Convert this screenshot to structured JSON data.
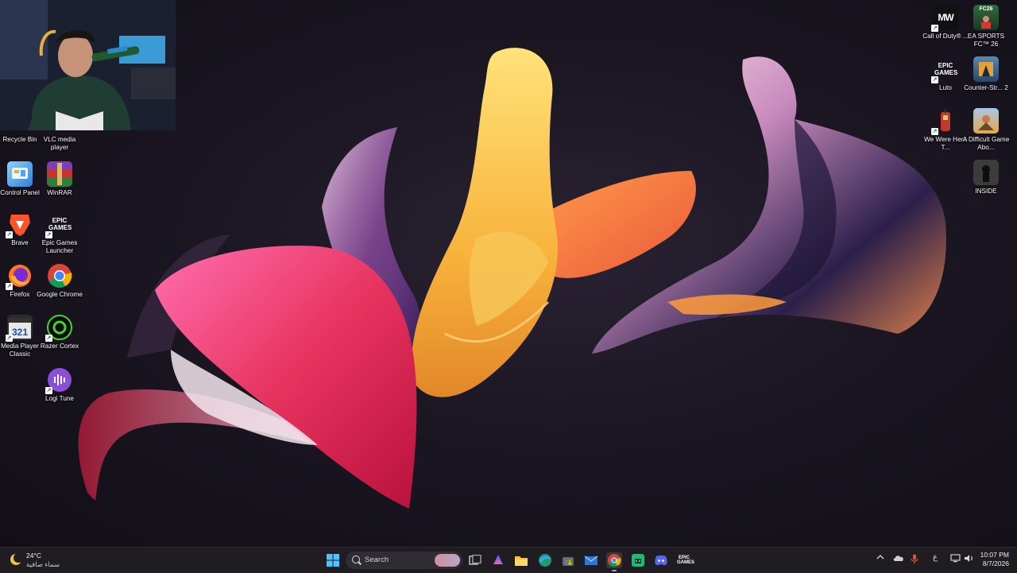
{
  "desktop_icons_left": [
    {
      "label": "Recycle Bin",
      "icon": "recycle-bin-icon"
    },
    {
      "label": "VLC media player",
      "icon": "vlc-icon"
    },
    {
      "label": "Control Panel",
      "icon": "control-panel-icon"
    },
    {
      "label": "WinRAR",
      "icon": "winrar-icon"
    },
    {
      "label": "Brave",
      "icon": "brave-icon"
    },
    {
      "label": "Epic Games Launcher",
      "icon": "epic-games-icon"
    },
    {
      "label": "Firefox",
      "icon": "firefox-icon"
    },
    {
      "label": "Google Chrome",
      "icon": "chrome-icon"
    },
    {
      "label": "Media Player Classic",
      "icon": "media-player-classic-icon"
    },
    {
      "label": "Razer Cortex",
      "icon": "razer-cortex-icon"
    },
    {
      "label": "Logi Tune",
      "icon": "logi-tune-icon"
    }
  ],
  "desktop_icons_right": [
    {
      "label": "Call of Duty® ...",
      "icon": "call-of-duty-icon",
      "glyph": "MW"
    },
    {
      "label": "EA SPORTS FC™ 26",
      "icon": "ea-sports-fc-icon",
      "glyph": "FC26"
    },
    {
      "label": "Luto",
      "icon": "luto-icon",
      "glyph": "EPIC GAMES"
    },
    {
      "label": "Counter-Str... 2",
      "icon": "counter-strike-icon"
    },
    {
      "label": "We Were Here T...",
      "icon": "we-were-here-icon"
    },
    {
      "label": "A Difficult Game Abo...",
      "icon": "difficult-game-icon"
    },
    {
      "label": "INSIDE",
      "icon": "inside-icon"
    }
  ],
  "epic_glyph": "EPIC GAMES",
  "weather": {
    "temp": "24°C",
    "condition": "سماء صافية"
  },
  "search": {
    "placeholder": "Search"
  },
  "taskbar_apps": [
    {
      "name": "start-button",
      "icon": "windows-icon"
    },
    {
      "name": "task-view",
      "icon": "task-view-icon"
    },
    {
      "name": "m365",
      "icon": "m365-icon"
    },
    {
      "name": "file-explorer",
      "icon": "folder-icon"
    },
    {
      "name": "edge",
      "icon": "edge-icon"
    },
    {
      "name": "store",
      "icon": "store-icon"
    },
    {
      "name": "mail",
      "icon": "mail-icon"
    },
    {
      "name": "chrome",
      "icon": "chrome-icon"
    },
    {
      "name": "android-app",
      "icon": "android-icon"
    },
    {
      "name": "discord",
      "icon": "discord-icon"
    },
    {
      "name": "epic-games",
      "icon": "epic-games-icon"
    }
  ],
  "tray": {
    "language": "ع",
    "time": "10:07 PM",
    "date": "8/7/2026"
  },
  "colors": {
    "taskbar": "#1f1d22",
    "accent": "#4aa3ff"
  }
}
